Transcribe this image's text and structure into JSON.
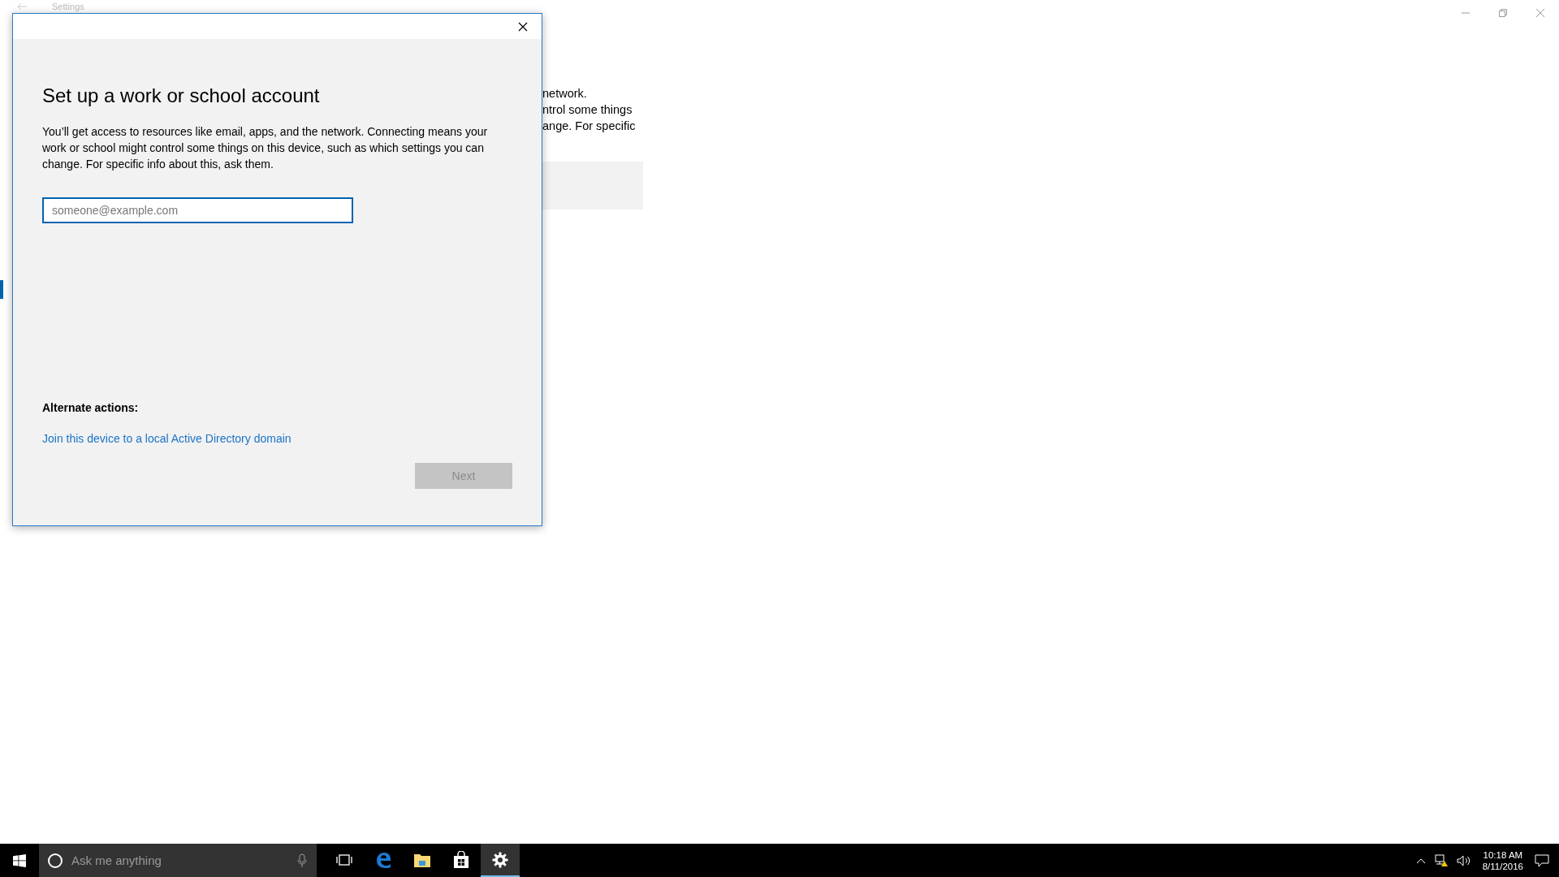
{
  "background_window": {
    "title": "Settings",
    "text_lines": [
      "network.",
      "ntrol some things",
      "ange. For specific"
    ]
  },
  "dialog": {
    "title": "Set up a work or school account",
    "description": "You’ll get access to resources like email, apps, and the network. Connecting means your work or school might control some things on this device, such as which settings you can change. For specific info about this, ask them.",
    "email_field": {
      "placeholder": "someone@example.com"
    },
    "alternate_actions_label": "Alternate actions:",
    "link": "Join this device to a local Active Directory domain",
    "next_button": {
      "label": "Next",
      "disabled": true
    }
  },
  "taskbar": {
    "search": {
      "placeholder": "Ask me anything"
    },
    "apps": [
      {
        "kind": "task-view",
        "selected": false
      },
      {
        "kind": "edge",
        "selected": false
      },
      {
        "kind": "explorer",
        "selected": false
      },
      {
        "kind": "store",
        "selected": false
      },
      {
        "kind": "settings",
        "selected": true
      }
    ],
    "clock": {
      "time": "10:18 AM",
      "date": "8/11/2016"
    }
  }
}
